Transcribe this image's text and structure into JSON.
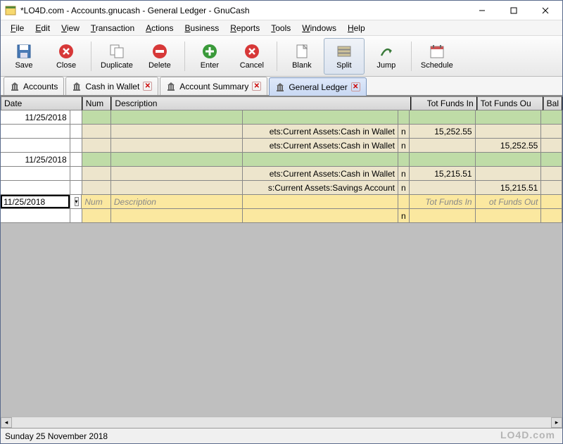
{
  "window": {
    "title": "*LO4D.com - Accounts.gnucash - General Ledger - GnuCash"
  },
  "menu": {
    "items": [
      "File",
      "Edit",
      "View",
      "Transaction",
      "Actions",
      "Business",
      "Reports",
      "Tools",
      "Windows",
      "Help"
    ]
  },
  "toolbar": {
    "buttons": [
      {
        "id": "save",
        "label": "Save"
      },
      {
        "id": "close",
        "label": "Close"
      },
      {
        "id": "sep",
        "label": ""
      },
      {
        "id": "duplicate",
        "label": "Duplicate"
      },
      {
        "id": "delete",
        "label": "Delete"
      },
      {
        "id": "sep",
        "label": ""
      },
      {
        "id": "enter",
        "label": "Enter"
      },
      {
        "id": "cancel",
        "label": "Cancel"
      },
      {
        "id": "sep",
        "label": ""
      },
      {
        "id": "blank",
        "label": "Blank"
      },
      {
        "id": "split",
        "label": "Split",
        "active": true
      },
      {
        "id": "jump",
        "label": "Jump"
      },
      {
        "id": "sep",
        "label": ""
      },
      {
        "id": "schedule",
        "label": "Schedule"
      }
    ]
  },
  "tabs": [
    {
      "label": "Accounts",
      "closable": false
    },
    {
      "label": "Cash in Wallet",
      "closable": true
    },
    {
      "label": "Account Summary",
      "closable": true
    },
    {
      "label": "General Ledger",
      "closable": true,
      "active": true
    }
  ],
  "columns": {
    "date": "Date",
    "num": "Num",
    "desc": "Description",
    "in": "Tot Funds In",
    "out": "Tot Funds Ou",
    "bal": "Bal"
  },
  "rows": [
    {
      "type": "header",
      "date": "11/25/2018",
      "bg": "green"
    },
    {
      "type": "split",
      "acct": "ets:Current Assets:Cash in Wallet",
      "n": "n",
      "in": "15,252.55",
      "bg": "beige"
    },
    {
      "type": "split",
      "acct": "ets:Current Assets:Cash in Wallet",
      "n": "n",
      "out": "15,252.55",
      "bg": "beige"
    },
    {
      "type": "header",
      "date": "11/25/2018",
      "bg": "green"
    },
    {
      "type": "split",
      "acct": "ets:Current Assets:Cash in Wallet",
      "n": "n",
      "in": "15,215.51",
      "bg": "beige"
    },
    {
      "type": "split",
      "acct": "s:Current Assets:Savings Account",
      "n": "n",
      "out": "15,215.51",
      "bg": "beige"
    },
    {
      "type": "edit",
      "date": "11/25/2018",
      "num_ph": "Num",
      "desc_ph": "Description",
      "in_ph": "Tot Funds In",
      "out_ph": "ot Funds Out",
      "bg": "yellow"
    },
    {
      "type": "blank-split",
      "n": "n",
      "bg": "yellow"
    }
  ],
  "status": {
    "date": "Sunday 25 November 2018"
  },
  "watermark": "LO4D.com"
}
